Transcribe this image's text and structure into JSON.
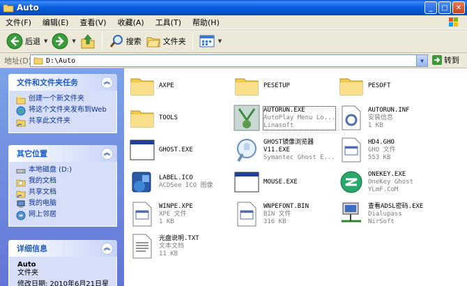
{
  "window": {
    "title": "Auto",
    "controls": {
      "minimize": "_",
      "maximize": "□",
      "close": "✕"
    }
  },
  "menu": [
    "文件(F)",
    "编辑(E)",
    "查看(V)",
    "收藏(A)",
    "工具(T)",
    "帮助(H)"
  ],
  "toolbar": {
    "back_label": "后退",
    "search_label": "搜索",
    "folders_label": "文件夹"
  },
  "address": {
    "label": "地址(D)",
    "value": "D:\\Auto",
    "go_label": "转到"
  },
  "left": {
    "tasks": {
      "title": "文件和文件夹任务",
      "items": [
        {
          "label": "创建一个新文件夹",
          "icon": "new-folder-icon"
        },
        {
          "label": "将这个文件夹发布到Web",
          "icon": "publish-web-icon"
        },
        {
          "label": "共享此文件夹",
          "icon": "share-folder-icon"
        }
      ]
    },
    "places": {
      "title": "其它位置",
      "items": [
        {
          "label": "本地磁盘 (D:)",
          "icon": "drive-icon"
        },
        {
          "label": "我的文档",
          "icon": "my-documents-icon"
        },
        {
          "label": "共享文档",
          "icon": "shared-documents-icon"
        },
        {
          "label": "我的电脑",
          "icon": "my-computer-icon"
        },
        {
          "label": "网上邻居",
          "icon": "network-icon"
        }
      ]
    },
    "details": {
      "title": "详细信息",
      "name": "Auto",
      "type": "文件夹",
      "modified": "修改日期: 2010年6月21日星"
    }
  },
  "files": [
    {
      "name": "AXPE",
      "line2": "",
      "line3": "",
      "icon": "folder-icon"
    },
    {
      "name": "PESETUP",
      "line2": "",
      "line3": "",
      "icon": "folder-icon"
    },
    {
      "name": "PESOFT",
      "line2": "",
      "line3": "",
      "icon": "folder-icon"
    },
    {
      "name": "TOOLS",
      "line2": "",
      "line3": "",
      "icon": "folder-icon"
    },
    {
      "name": "AUTORUN.EXE",
      "line2": "AutoPlay Menu Lo...",
      "line3": "Linasoft",
      "icon": "autoplay-app-icon"
    },
    {
      "name": "AUTORUN.INF",
      "line2": "安装信息",
      "line3": "1 KB",
      "icon": "inf-file-icon"
    },
    {
      "name": "GHOST.EXE",
      "line2": "",
      "line3": "",
      "icon": "exe-window-icon"
    },
    {
      "name": "GHOST镜像浏览器",
      "line2": "V11.EXE",
      "line3": "Symantec Ghost E...",
      "icon": "ghost-explorer-icon"
    },
    {
      "name": "HD4.GHO",
      "line2": "GHO 文件",
      "line3": "553 KB",
      "icon": "generic-file-icon"
    },
    {
      "name": "LABEL.ICO",
      "line2": "ACDSee ICO 图像",
      "line3": "",
      "icon": "acdsee-image-icon"
    },
    {
      "name": "MOUSE.EXE",
      "line2": "",
      "line3": "",
      "icon": "exe-window-icon"
    },
    {
      "name": "ONEKEY.EXE",
      "line2": "OneKey Ghost",
      "line3": "YLmF.CoM",
      "icon": "onekey-ghost-icon"
    },
    {
      "name": "WINPE.XPE",
      "line2": "XPE 文件",
      "line3": "1 KB",
      "icon": "generic-file-icon"
    },
    {
      "name": "WNPEFONT.BIN",
      "line2": "BIN 文件",
      "line3": "316 KB",
      "icon": "generic-file-icon"
    },
    {
      "name": "查看ADSL密码.EXE",
      "line2": "Dialupass",
      "line3": "NirSoft",
      "icon": "network-computer-icon"
    },
    {
      "name": "光盘说明.TXT",
      "line2": "文本文档",
      "line3": "11 KB",
      "icon": "text-file-icon"
    }
  ]
}
